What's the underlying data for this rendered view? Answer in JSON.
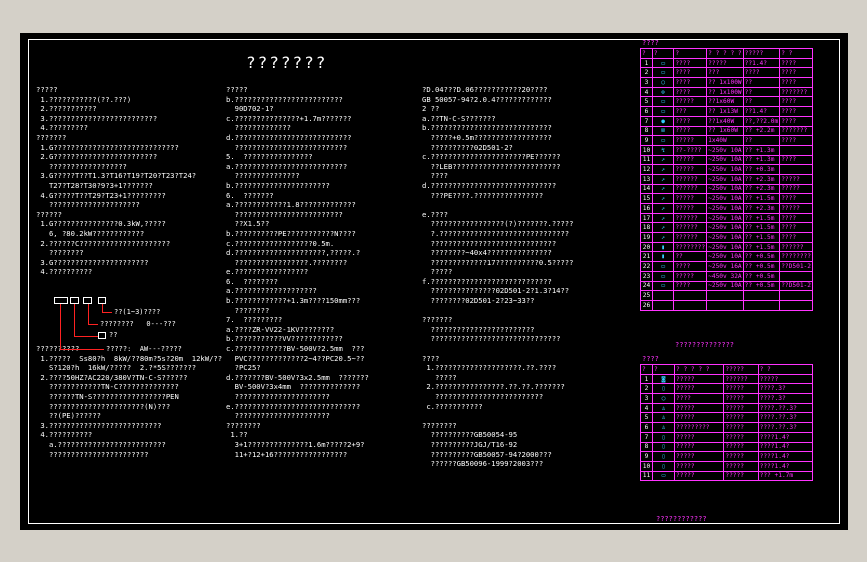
{
  "title": "???????",
  "col1": [
    "?????",
    " 1.???????????(??.???)",
    " 2.???????????",
    " 3.?????????????????????????",
    " 4.?????????",
    "???????",
    " 1.G?????????????????????????????",
    " 2.G????????????????????????",
    "   ??????????????????",
    " 3.G?????T??T1.3?T16?T19?T20?T23?T24?",
    "   T27?T28?T30?9?3+1???????",
    " 4.G?????T??T29?T23+1?????????",
    "   ?????????????????????",
    "??????",
    " 1.G???????????????0.3kW,?????",
    "   6, ?80.2kW????????????",
    " 2.??????C?????????????????????",
    "   ????????",
    " 3.G??????????????????????",
    " 4.??????????",
    "",
    "",
    "",
    "",
    "",
    "",
    "",
    "??????????",
    " 1.?????  Ss80?h  8kW/??80m?5s?20m  12kW/??",
    "   S?120?h  16kW/?????  2.?*5S???????",
    " 2.????50HZ?AC220/380V?TN-C-S??????",
    "   ????????????TN-C??????????????",
    "   ??????TN-S?????????????????PEN",
    "   ??????????????????????(N)???",
    "   ??(PE)??????",
    " 3.??????????????????????????",
    " 4.??????????",
    "   a.?????????????????????????",
    "   ???????????????????????"
  ],
  "col2": [
    "?????",
    "b.?????????????????????????",
    "  90D702-1?",
    "c.???????????????+1.7m???????",
    "  ?????????????",
    "d.???????????????????????????",
    "  ??????????????????????????",
    "5.  ????????????????",
    "a.??????????????????????????",
    "  ???????????????",
    "b.??????????????????????",
    "6.  ???????",
    "a.????????????1.8?????????????",
    "  ?????????????????????????",
    "  ??X1.5??",
    "b.??????????PE???????????N????",
    "c.??????????????????0.5m.",
    "d.?????????????????????,?????.?",
    "  ?????????????????.????????",
    "e.?????????????????",
    "6.  ????????",
    "a.???????????????????",
    "b.????????????+1.3m????150mm???",
    "  ????????",
    "7.  ?????????",
    "a.????ZR-VV22-1KV????????",
    "b.???????????VV????????????",
    "c.????????????BV-500V?2.5mm  ???",
    "  PVC?????????????2~4??PC20.5~??",
    "  ?PC25?",
    "d.???????BV-500V?3x2.5mm  ???????",
    "  BV-500V?3x4mm  ??????????????",
    "  ??????????????????????",
    "e.?????????????????????????????",
    "  ??????????????????????",
    "????????",
    " 1.??",
    "  3+1??????????????1.6m?????2+9?",
    "  11+?12+16?????????????????"
  ],
  "col3": [
    "?D.04???D.06???????????20????",
    "GB 50057-94?2.0.4?????????????",
    "2 ??",
    "a.??TN-C-S???????",
    "b.????????????????????????????",
    "  ?????+0.5m??????????????????",
    "  ??????????02D501-2?",
    "c.??????????????????????PE??????",
    "  ??LEB?????????????????????????",
    "  ????",
    "d.?????????????????????????????",
    "  ???PE????.????????????????",
    "",
    "e.????",
    "  ?????????????????(?)???????.?????",
    "  ?.??????????????????????????????",
    "  ?????????????????????????????",
    "  ????????~40x4???????????????",
    "  ?????????????17??????????0.5?????",
    "  ?????",
    "f.????????????????????????????",
    "  ???????????????02D501-2?1.3?14??",
    "  ????????02D501-2?23~33??",
    "",
    "???????",
    "  ????????????????????????",
    "  ??????????????????????????????",
    "",
    "????",
    " 1.????????????????????.??.????",
    "   ?????",
    " 2.????????????????.??.??.???????",
    "   ?????????????????????????",
    " c.???????????",
    "",
    "????????",
    "  ??????????GB50054-95",
    "  ??????????JGJ/T16-92",
    "  ??????????GB50057-94?2000???",
    "  ??????GB50096-1999?2003???"
  ],
  "legend": {
    "row1": "??(1~3)????",
    "row2": "????????   0---???",
    "row3": "??",
    "row4": "?????:  AW---?????"
  },
  "table1": {
    "title": "????",
    "footer": "??????????????",
    "header": [
      "?",
      "?",
      "?",
      "? ? ? ? ?",
      "?????",
      "? ?"
    ],
    "rows": [
      [
        "1",
        "▭",
        "????",
        "?????",
        "??1.4?",
        "????"
      ],
      [
        "2",
        "▭",
        "????",
        "???",
        "????",
        "????"
      ],
      [
        "3",
        "○",
        "????",
        "?? 1x100W",
        "??",
        "????"
      ],
      [
        "4",
        "⊗",
        "????",
        "?? 1x100W",
        "??",
        "???????"
      ],
      [
        "5",
        "▭",
        "?????",
        "??1x60W",
        "??",
        "????"
      ],
      [
        "6",
        "▭",
        "???",
        "?? 1x13W",
        "??1.4?",
        "????"
      ],
      [
        "7",
        "●",
        "????",
        "??1x40W",
        "??,??2.0m",
        "????"
      ],
      [
        "8",
        "⊠",
        "????",
        "?? 1x60W",
        "?? +2.2m",
        "???????"
      ],
      [
        "9",
        "▭",
        "?????",
        "1x40W",
        "??",
        "????"
      ],
      [
        "10",
        "↯",
        "??-????",
        "~250v 10A",
        "?? +1.3m",
        ""
      ],
      [
        "11",
        "↗",
        "?????",
        "~250v 10A",
        "?? +1.3m",
        "????"
      ],
      [
        "12",
        "↗",
        "?????",
        "~250v 10A",
        "?? +0.3m",
        ""
      ],
      [
        "13",
        "↗",
        "??????",
        "~250v 10A",
        "?? +2.3m",
        "?????"
      ],
      [
        "14",
        "↗",
        "??????",
        "~250v 10A",
        "?? +2.3m",
        "?????"
      ],
      [
        "15",
        "↗",
        "?????",
        "~250v 10A",
        "?? +1.5m",
        "????"
      ],
      [
        "16",
        "↗",
        "?????",
        "~250v 10A",
        "?? +2.3m",
        "?????"
      ],
      [
        "17",
        "↗",
        "??????",
        "~250v 10A",
        "?? +1.5m",
        "????"
      ],
      [
        "18",
        "↗",
        "??????",
        "~250v 10A",
        "?? +1.5m",
        "????"
      ],
      [
        "19",
        "↗",
        "??????",
        "~250v 10A",
        "?? +1.5m",
        "????"
      ],
      [
        "20",
        "▮",
        "????????",
        "~250v 10A",
        "?? +1.5m",
        "??????"
      ],
      [
        "21",
        "▮",
        "??",
        "~250v 10A",
        "?? +0.5m",
        "????????"
      ],
      [
        "22",
        "▭",
        "????",
        "~250v 16A",
        "?? +0.5m",
        "??D501-2"
      ],
      [
        "23",
        "▭",
        "?????",
        "~450v 32A",
        "?? +0.5m",
        ""
      ],
      [
        "24",
        "▭",
        "????",
        "~250v 10A",
        "?? +0.5m",
        "??D501-2"
      ],
      [
        "25",
        "",
        "",
        "",
        "",
        ""
      ],
      [
        "26",
        "",
        "",
        "",
        "",
        ""
      ]
    ]
  },
  "table2": {
    "title": "????",
    "footer": "????????????",
    "header": [
      "?",
      "?",
      "? ? ? ? ?",
      "?????",
      "? ?"
    ],
    "rows": [
      [
        "1",
        "◙",
        "?????",
        "??????",
        "?????"
      ],
      [
        "2",
        "▯",
        "?????",
        "?????",
        "????.3?"
      ],
      [
        "3",
        "○",
        "????",
        "?????",
        "????.3?"
      ],
      [
        "4",
        "♙",
        "?????",
        "?????",
        "????.??.3?"
      ],
      [
        "5",
        "♙",
        "?????",
        "?????",
        "????.??.3?"
      ],
      [
        "6",
        "♙",
        "?????????",
        "?????",
        "????.??.3?"
      ],
      [
        "7",
        "▯",
        "?????",
        "?????",
        "????1.4?"
      ],
      [
        "8",
        "▯",
        "?????",
        "?????",
        "????1.4?"
      ],
      [
        "9",
        "▯",
        "?????",
        "?????",
        "????1.4?"
      ],
      [
        "10",
        "▯",
        "?????",
        "?????",
        "????1.4?"
      ],
      [
        "11",
        "▭",
        "?????",
        "?????",
        "???  +1.7m"
      ]
    ]
  }
}
